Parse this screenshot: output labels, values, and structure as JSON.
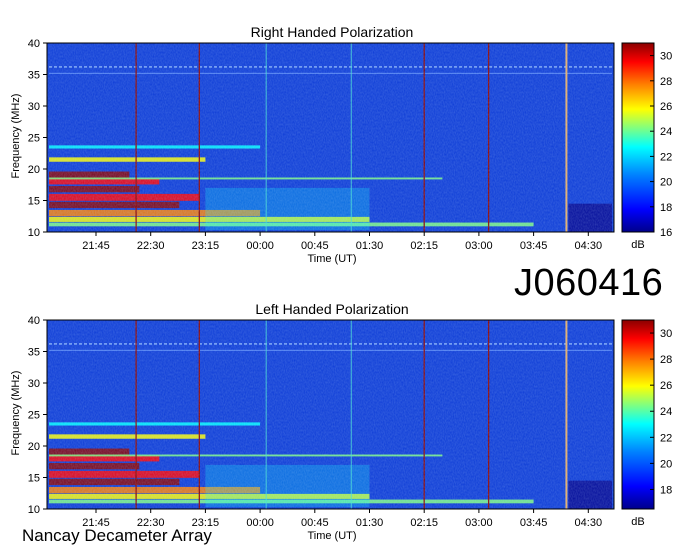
{
  "observation_id": "J060416",
  "instrument": "Nancay Decameter Array",
  "colors": {
    "colormap": [
      "#00008b",
      "#0000ff",
      "#0080ff",
      "#00ffff",
      "#80ff80",
      "#ffff00",
      "#ff8000",
      "#ff0000",
      "#8b0000"
    ],
    "marker_line": "#8b0000",
    "cyan_line": "#40e0d0"
  },
  "chart_data": [
    {
      "type": "heatmap",
      "title": "Right Handed Polarization",
      "xlabel": "Time (UT)",
      "ylabel": "Frequency (MHz)",
      "x_ticks": [
        "21:45",
        "22:30",
        "23:15",
        "00:00",
        "00:45",
        "01:30",
        "02:15",
        "03:00",
        "03:45",
        "04:30"
      ],
      "y_ticks": [
        10,
        15,
        20,
        25,
        30,
        35,
        40
      ],
      "ylim": [
        10,
        40
      ],
      "colorbar": {
        "label": "dB",
        "ticks": [
          16,
          18,
          20,
          22,
          24,
          26,
          28,
          30
        ],
        "range": [
          16,
          31
        ]
      },
      "marker_times": [
        "22:18",
        "23:10",
        "02:15",
        "03:08",
        "04:12"
      ],
      "bright_times": [
        "00:05",
        "01:15",
        "04:12"
      ]
    },
    {
      "type": "heatmap",
      "title": "Left Handed Polarization",
      "xlabel": "Time (UT)",
      "ylabel": "Frequency (MHz)",
      "x_ticks": [
        "21:45",
        "22:30",
        "23:15",
        "00:00",
        "00:45",
        "01:30",
        "02:15",
        "03:00",
        "03:45",
        "04:30"
      ],
      "y_ticks": [
        10,
        15,
        20,
        25,
        30,
        35,
        40
      ],
      "ylim": [
        10,
        40
      ],
      "colorbar": {
        "label": "dB",
        "ticks": [
          18,
          20,
          22,
          24,
          26,
          28,
          30
        ],
        "range": [
          16.5,
          31
        ]
      },
      "marker_times": [
        "22:18",
        "23:10",
        "02:15",
        "03:08",
        "04:12"
      ],
      "bright_times": [
        "00:05",
        "01:15",
        "04:12"
      ]
    }
  ]
}
